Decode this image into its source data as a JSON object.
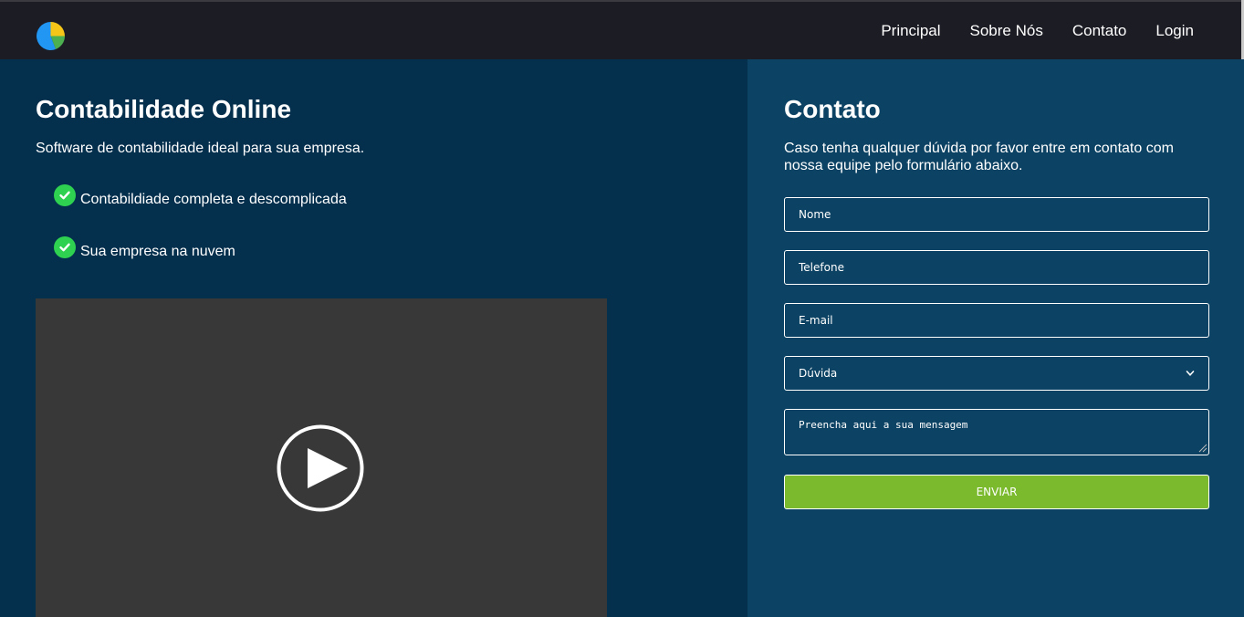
{
  "nav": {
    "logo_icon": "pie-chart-icon",
    "items": [
      "Principal",
      "Sobre Nós",
      "Contato",
      "Login"
    ]
  },
  "hero": {
    "title": "Contabilidade Online",
    "subtitle": "Software de contabilidade ideal para sua empresa.",
    "features": [
      {
        "icon": "check-circle-icon",
        "text": "Contabildiade completa e descomplicada"
      },
      {
        "icon": "check-circle-icon",
        "text": "Sua empresa na nuvem"
      }
    ],
    "video": {
      "icon": "play-circle-icon"
    }
  },
  "contact": {
    "title": "Contato",
    "description": "Caso tenha qualquer dúvida por favor entre em contato com nossa equipe pelo formulário abaixo.",
    "name_placeholder": "Nome",
    "phone_placeholder": "Telefone",
    "email_placeholder": "E-mail",
    "subject_selected": "Dúvida",
    "message_placeholder": "Preencha aqui a sua mensagem",
    "submit_label": "ENVIAR"
  },
  "colors": {
    "header_bg": "#1c1c25",
    "left_bg": "#042f4d",
    "right_bg": "#0c4263",
    "check_green": "#2ed150",
    "button_green": "#7aba2c",
    "video_bg": "#383838"
  }
}
